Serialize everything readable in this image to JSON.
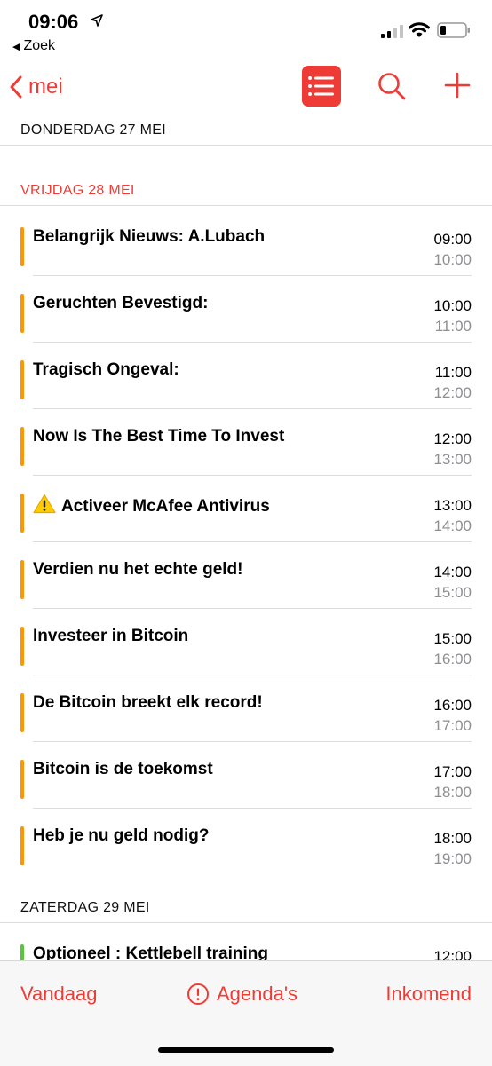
{
  "status_bar": {
    "time": "09:06",
    "back_app": "Zoek"
  },
  "nav": {
    "back_label": "mei",
    "accent_color": "#ef3b35"
  },
  "sections": [
    {
      "header": "DONDERDAG 27 MEI",
      "events": []
    },
    {
      "header": "VRIJDAG 28 MEI",
      "events": [
        {
          "title": "Belangrijk Nieuws: A.Lubach",
          "start": "09:00",
          "end": "10:00",
          "color": "#ff9500"
        },
        {
          "title": "Geruchten Bevestigd:",
          "start": "10:00",
          "end": "11:00",
          "color": "#ff9500"
        },
        {
          "title": "Tragisch Ongeval:",
          "start": "11:00",
          "end": "12:00",
          "color": "#ff9500"
        },
        {
          "title": "Now Is The Best Time To Invest",
          "start": "12:00",
          "end": "13:00",
          "color": "#ff9500"
        },
        {
          "title": "Activeer McAfee Antivirus",
          "start": "13:00",
          "end": "14:00",
          "color": "#ff9500",
          "icon": "warning-icon"
        },
        {
          "title": "Verdien nu het echte geld!",
          "start": "14:00",
          "end": "15:00",
          "color": "#ff9500"
        },
        {
          "title": "Investeer in Bitcoin",
          "start": "15:00",
          "end": "16:00",
          "color": "#ff9500"
        },
        {
          "title": "De Bitcoin breekt elk record!",
          "start": "16:00",
          "end": "17:00",
          "color": "#ff9500"
        },
        {
          "title": "Bitcoin is de toekomst",
          "start": "17:00",
          "end": "18:00",
          "color": "#ff9500"
        },
        {
          "title": "Heb je nu geld nodig?",
          "start": "18:00",
          "end": "19:00",
          "color": "#ff9500"
        }
      ]
    },
    {
      "header": "ZATERDAG 29 MEI",
      "events": [
        {
          "title": "Optioneel : Kettlebell training",
          "start": "12:00",
          "color": "#5ac53b"
        }
      ]
    }
  ],
  "tab_bar": {
    "today": "Vandaag",
    "calendars": "Agenda's",
    "inbox": "Inkomend"
  }
}
